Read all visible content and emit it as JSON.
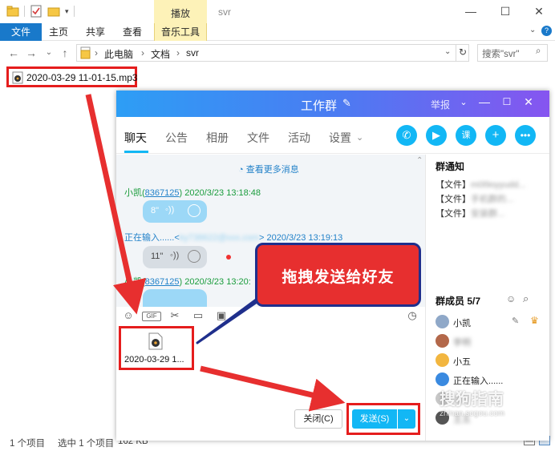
{
  "explorer": {
    "window_title": "svr",
    "context_tab": "播放",
    "ribbon_tabs": [
      "文件",
      "主页",
      "共享",
      "查看",
      "音乐工具"
    ],
    "address_segments": [
      "此电脑",
      "文档",
      "svr"
    ],
    "search_placeholder": "搜索\"svr\"",
    "file_name": "2020-03-29 11-01-15.mp3",
    "status": {
      "item_count": "1 个项目",
      "selected": "选中 1 个项目",
      "size": "162 KB"
    }
  },
  "qq": {
    "title": "工作群",
    "report": "举报",
    "tabs": [
      "聊天",
      "公告",
      "相册",
      "文件",
      "活动",
      "设置"
    ],
    "header_action_icons": [
      "phone-icon",
      "video-icon",
      "lesson-icon",
      "add-app-icon",
      "more-icon"
    ],
    "more_messages": "查看更多消息",
    "messages": [
      {
        "sender": "小凯",
        "uid": "8367125",
        "time": "2020/3/23 13:18:48",
        "duration": "8\""
      },
      {
        "sender": "正在输入......",
        "uid": "ky738622@xxx.com",
        "time": "2020/3/23 13:19:13",
        "duration": "11\""
      },
      {
        "sender": "小凯",
        "uid": "8367125",
        "time": "2020/3/23 13:20:"
      }
    ],
    "attachment_name": "2020-03-29 1...",
    "close_label": "关闭(C)",
    "send_label": "发送(S)",
    "side": {
      "notice_title": "群通知",
      "notices": [
        {
          "tag": "【文件】",
          "text": "m0l9oyyudd..."
        },
        {
          "tag": "【文件】",
          "text": "手机群的..."
        },
        {
          "tag": "【文件】",
          "text": "安装群..."
        }
      ],
      "members_title": "群成员 5/7",
      "members": [
        "小凯",
        "李明",
        "小五",
        "正在输入......",
        "张三",
        "王五"
      ]
    }
  },
  "callout": {
    "text": "拖拽发送给好友"
  },
  "watermark": {
    "main": "搜狗指南",
    "sub": "zhinan.sogou.com"
  },
  "colors": {
    "accent_red": "#e51d1d",
    "qq_blue": "#12b7f5",
    "explorer_blue": "#1979ca"
  }
}
